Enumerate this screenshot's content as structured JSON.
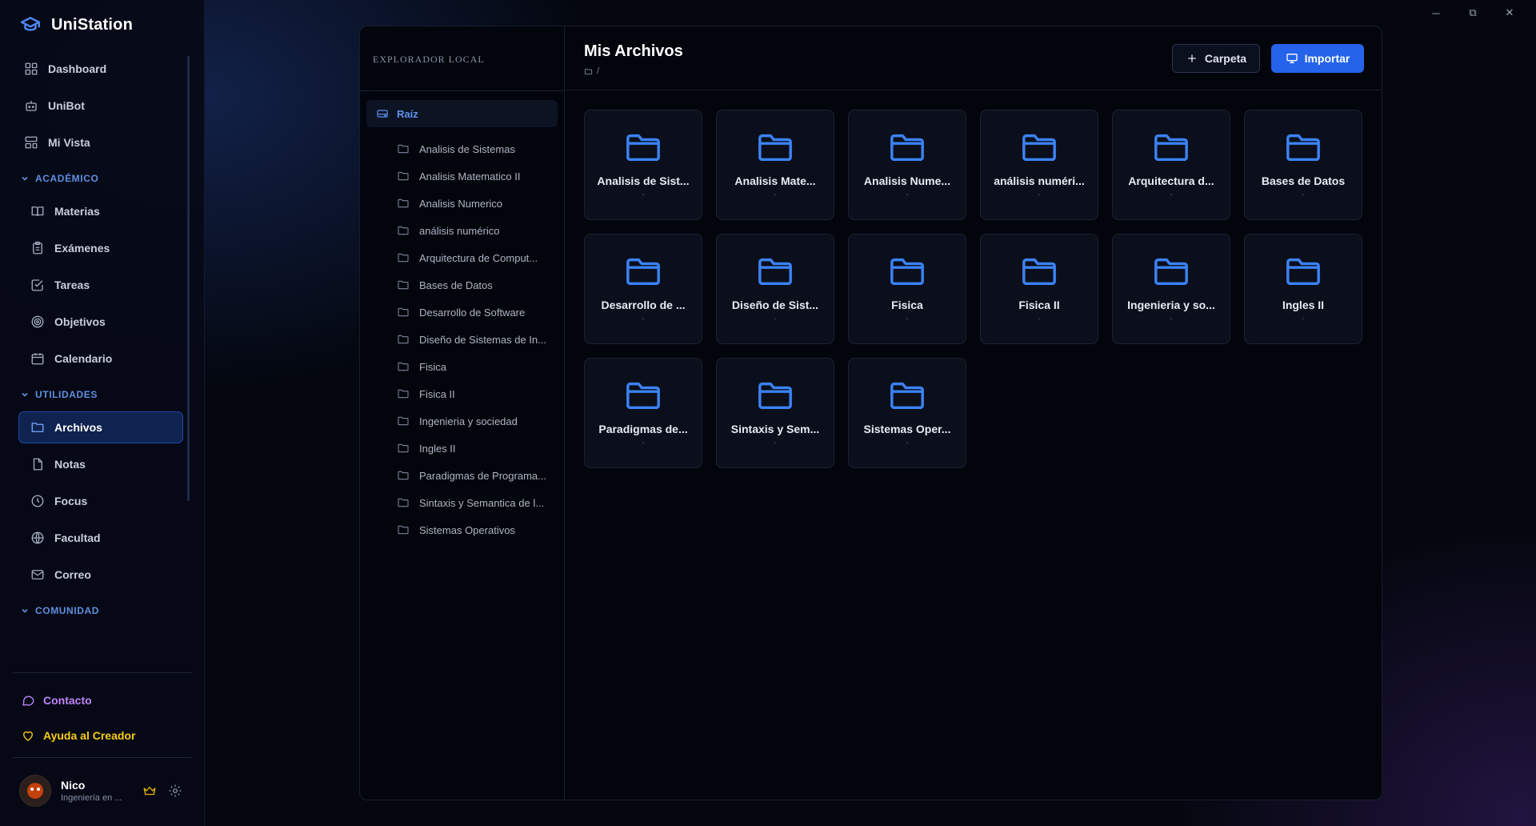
{
  "app": {
    "name": "UniStation"
  },
  "window_controls": {
    "minimize": "─",
    "restore": "⧉",
    "close": "✕"
  },
  "nav": {
    "top": [
      {
        "label": "Dashboard",
        "icon": "dashboard-icon"
      },
      {
        "label": "UniBot",
        "icon": "bot-icon"
      },
      {
        "label": "Mi Vista",
        "icon": "layout-icon"
      }
    ],
    "sections": [
      {
        "title": "ACADÉMICO",
        "items": [
          {
            "label": "Materias",
            "icon": "book-icon"
          },
          {
            "label": "Exámenes",
            "icon": "clipboard-icon"
          },
          {
            "label": "Tareas",
            "icon": "checkbox-icon"
          },
          {
            "label": "Objetivos",
            "icon": "target-icon"
          },
          {
            "label": "Calendario",
            "icon": "calendar-icon"
          }
        ]
      },
      {
        "title": "UTILIDADES",
        "items": [
          {
            "label": "Archivos",
            "icon": "folder-icon",
            "active": true
          },
          {
            "label": "Notas",
            "icon": "note-icon"
          },
          {
            "label": "Focus",
            "icon": "clock-icon"
          },
          {
            "label": "Facultad",
            "icon": "globe-icon"
          },
          {
            "label": "Correo",
            "icon": "mail-icon"
          }
        ]
      },
      {
        "title": "COMUNIDAD",
        "items": []
      }
    ],
    "contact": "Contacto",
    "support": "Ayuda al Creador"
  },
  "user": {
    "name": "Nico",
    "subtitle": "Ingeniería en ..."
  },
  "explorer": {
    "title": "EXPLORADOR LOCAL",
    "root": "Raíz",
    "folders": [
      "Analisis de Sistemas",
      "Analisis Matematico II",
      "Analisis Numerico",
      "análisis numérico",
      "Arquitectura de Comput...",
      "Bases de Datos",
      "Desarrollo de Software",
      "Diseño de Sistemas de In...",
      "Fisica",
      "Fisica II",
      "Ingenieria y sociedad",
      "Ingles II",
      "Paradigmas de Programa...",
      "Sintaxis y Semantica de l...",
      "Sistemas Operativos"
    ]
  },
  "main": {
    "title": "Mis Archivos",
    "breadcrumb": "/",
    "new_folder_label": "Carpeta",
    "import_label": "Importar",
    "cards": [
      {
        "name": "Analisis de Sist...",
        "meta": "-"
      },
      {
        "name": "Analisis Mate...",
        "meta": "-"
      },
      {
        "name": "Analisis Nume...",
        "meta": "-"
      },
      {
        "name": "análisis numéri...",
        "meta": "-"
      },
      {
        "name": "Arquitectura d...",
        "meta": "-"
      },
      {
        "name": "Bases de Datos",
        "meta": "-"
      },
      {
        "name": "Desarrollo de ...",
        "meta": "-"
      },
      {
        "name": "Diseño de Sist...",
        "meta": "-"
      },
      {
        "name": "Fisica",
        "meta": "-"
      },
      {
        "name": "Fisica II",
        "meta": "-"
      },
      {
        "name": "Ingenieria y so...",
        "meta": "-"
      },
      {
        "name": "Ingles II",
        "meta": "-"
      },
      {
        "name": "Paradigmas de...",
        "meta": "-"
      },
      {
        "name": "Sintaxis y Sem...",
        "meta": "-"
      },
      {
        "name": "Sistemas Oper...",
        "meta": "-"
      }
    ]
  },
  "colors": {
    "accent": "#2563eb",
    "folder": "#3b82f6",
    "contact": "#c084fc",
    "support": "#facc15"
  }
}
